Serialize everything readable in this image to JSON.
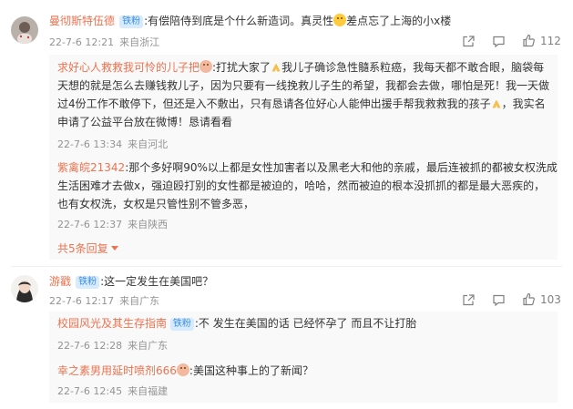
{
  "comments": [
    {
      "user": "曼彻斯特伍德",
      "badge": "铁粉",
      "text": ":有偿陪侍到底是个什么新造词。真灵性",
      "text_tail": "差点忘了上海的小x楼",
      "date": "22-7-6 12:21",
      "location": "来自浙江",
      "like_count": "112",
      "replies": [
        {
          "user": "求好心人救救我可怜的儿子把",
          "line1_a": ":打扰大家了",
          "line1_b": "我儿子确诊急性髓系粒癌，我每天都不敢合眼，脑袋每",
          "line2": "天想的就是怎么去赚钱救儿子，因为只要有一线挽救儿子生的希望，我都会去做，哪怕是死！我一天做",
          "line3": "过4份工作不敢停下，但还是入不敷出，只有恳请各位好心人能伸出援手帮我救救我的孩子",
          "line3_b": "，我实名",
          "line4": "申请了公益平台放在微博！恳请看看",
          "date": "22-7-6 13:34",
          "location": "来自河北"
        },
        {
          "user": "紫禽皖21342",
          "line1": ":那个多好啊90%以上都是女性加害者以及黑老大和他的亲戚，最后连被抓的都被女权洗成",
          "line2": "生活困难才去做x，强迫殴打别的女性都是被迫的，哈哈，然而被迫的根本没抓抓的都是最大恶疾的，",
          "line3": "也有女权洗，女权是只管性别不管多恶，",
          "date": "22-7-6 12:37",
          "location": "来自陕西"
        }
      ],
      "more_replies": "共5条回复"
    },
    {
      "user": "游戳",
      "badge": "铁粉",
      "text": ":这一定发生在美国吧？",
      "date": "22-7-6 12:17",
      "location": "来自广东",
      "like_count": "103",
      "replies": [
        {
          "user": "校园风光及其生存指南",
          "badge": "铁粉",
          "text": ":不 发生在美国的话 已经怀孕了 而且不让打胎",
          "date": "22-7-6 12:28",
          "location": "来自广东"
        },
        {
          "user": "幸之素男用延时喷剂666",
          "text": ":美国这种事上的了新闻？",
          "date": "22-7-6 12:45",
          "location": "来自福建"
        }
      ]
    }
  ],
  "colors": {
    "username": "#eb7350",
    "badge_bg": "#d7ebff",
    "badge_text": "#3d8fe3",
    "meta": "#939393"
  },
  "icons": [
    "share-icon",
    "comment-icon",
    "like-icon",
    "expand-chevron-icon"
  ]
}
